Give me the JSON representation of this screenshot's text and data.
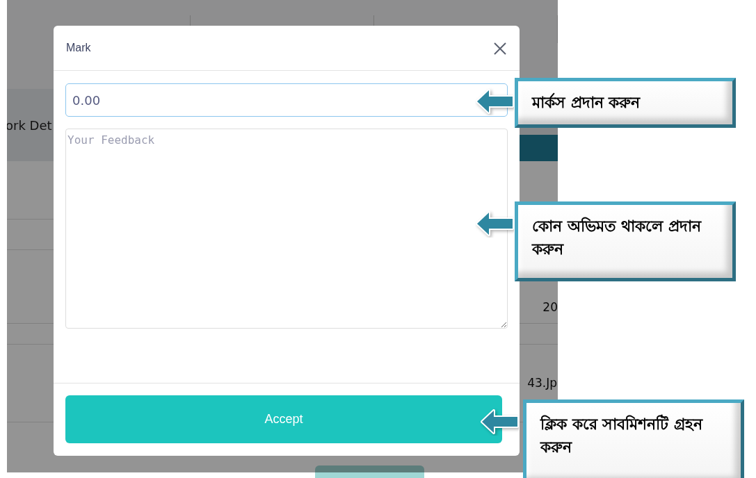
{
  "background": {
    "tab_label": "ork Det",
    "cell_text": "20",
    "file_name": "43.Jp"
  },
  "modal": {
    "title": "Mark",
    "mark_field": {
      "value": "0.00"
    },
    "feedback_field": {
      "placeholder": "Your Feedback"
    },
    "accept_button": "Accept"
  },
  "callouts": [
    {
      "text": "মার্কস প্রদান করুন"
    },
    {
      "text": "কোন অভিমত থাকলে প্রদান করুন"
    },
    {
      "text": "ক্লিক করে সাবমিশনটি গ্রহন করুন"
    }
  ]
}
